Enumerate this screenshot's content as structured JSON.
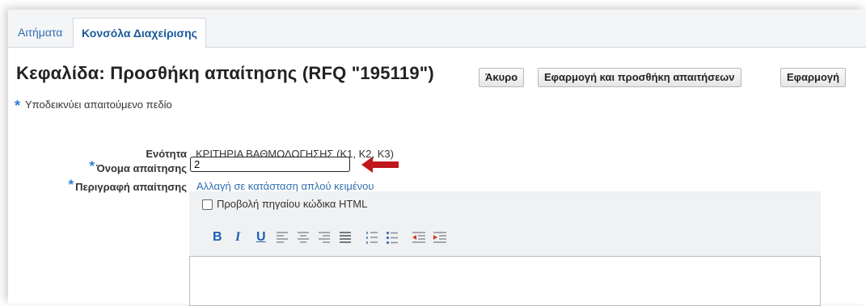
{
  "tabs": [
    {
      "label": "Αιτήματα"
    },
    {
      "label": "Κονσόλα Διαχείρισης"
    }
  ],
  "page_title": "Κεφαλίδα: Προσθήκη απαίτησης (RFQ \"195119\")",
  "buttons": {
    "cancel": "Άκυρο",
    "apply_add": "Εφαρμογή και προσθήκη απαιτήσεων",
    "apply": "Εφαρμογή"
  },
  "required_note": {
    "star": "*",
    "text": "Υποδεικνύει απαιτούμενο πεδίο"
  },
  "form": {
    "section_label": "Ενότητα",
    "section_value": "ΚΡΙΤΗΡΙΑ ΒΑΘΜΟΛΟΓΗΣΗΣ (Κ1, Κ2, Κ3)",
    "name_label": "Όνομα απαίτησης",
    "name_value": "2",
    "description_label": "Περιγραφή απαίτησης",
    "plain_text_link": "Αλλαγή σε κατάσταση απλού κειμένου",
    "star": "*"
  },
  "editor": {
    "view_source_label": "Προβολή πηγαίου κώδικα HTML",
    "view_source_checked": false,
    "toolbar": {
      "bold": "B",
      "italic": "I",
      "underline": "U"
    }
  },
  "colors": {
    "accent": "#2f6fb0",
    "arrow": "#c0161c",
    "toolbar_icon": "#1a5fb4"
  }
}
